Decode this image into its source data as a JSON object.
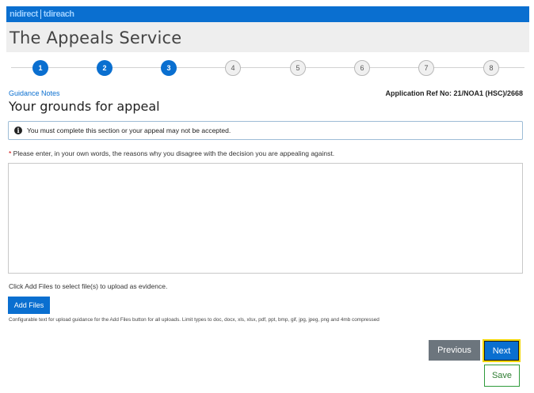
{
  "brand": {
    "logo_part1": "nidirect",
    "logo_part2": "tdireach",
    "logo_accent": "#0a6fd0"
  },
  "app_title": "The Appeals Service",
  "stepper": {
    "current_step": 3,
    "steps": [
      {
        "label": "1",
        "state": "complete"
      },
      {
        "label": "2",
        "state": "complete"
      },
      {
        "label": "3",
        "state": "current"
      },
      {
        "label": "4",
        "state": "pending"
      },
      {
        "label": "5",
        "state": "pending"
      },
      {
        "label": "6",
        "state": "pending"
      },
      {
        "label": "7",
        "state": "pending"
      },
      {
        "label": "8",
        "state": "pending"
      }
    ]
  },
  "guidance_link": "Guidance Notes",
  "application_ref": "Application Ref No: 21/NOA1 (HSC)/2668",
  "page_title": "Your grounds for appeal",
  "notice": {
    "icon": "info-icon",
    "text": "You must complete this section or your appeal may not be accepted."
  },
  "reasons_field": {
    "required_marker": "*",
    "prompt": " Please enter, in your own words, the reasons why you disagree with the decision you are appealing against.",
    "value": ""
  },
  "files": {
    "hint": "Click Add Files to select file(s) to upload as evidence.",
    "add_button": "Add Files",
    "help_text": "Configurable text for upload guidance for the Add Files button for all uploads. Limit types to doc, docx, xls, xlsx, pdf, ppt, bmp, gif, jpg, jpeg, png and 4mb compressed"
  },
  "nav": {
    "previous": "Previous",
    "next": "Next",
    "save": "Save"
  }
}
